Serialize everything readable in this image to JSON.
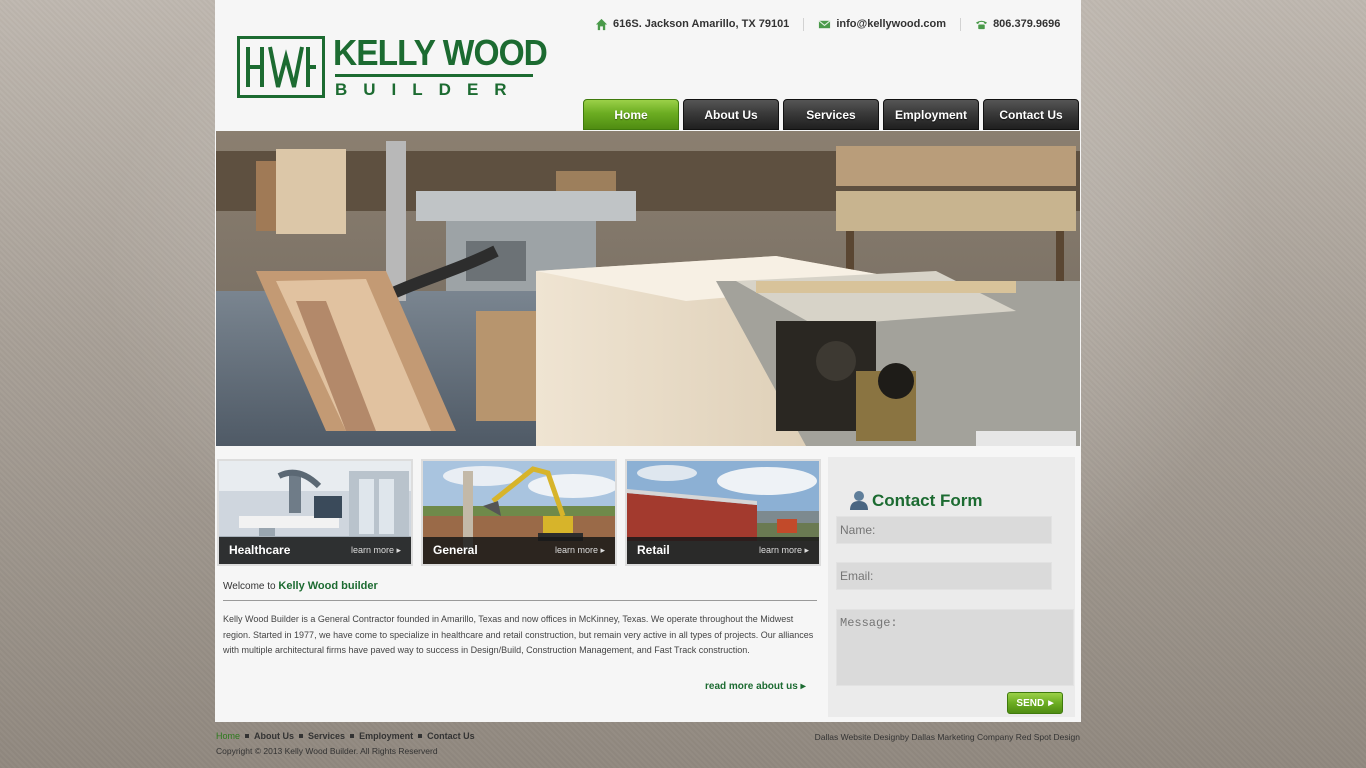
{
  "brand": {
    "title": "KELLY WOOD",
    "subtitle": "BUILDER",
    "color": "#1c6b31"
  },
  "contact_bar": {
    "address": "616S. Jackson Amarillo, TX 79101",
    "email": "info@kellywood.com",
    "phone": "806.379.9696",
    "icons": [
      "home-icon",
      "envelope-icon",
      "phone-icon"
    ]
  },
  "nav": {
    "items": [
      {
        "label": "Home",
        "active": true
      },
      {
        "label": "About Us",
        "active": false
      },
      {
        "label": "Services",
        "active": false
      },
      {
        "label": "Employment",
        "active": false
      },
      {
        "label": "Contact Us",
        "active": false
      }
    ],
    "active_color": "#6cad22"
  },
  "features": [
    {
      "title": "Healthcare",
      "more": "learn more ▸"
    },
    {
      "title": "General",
      "more": "learn more ▸"
    },
    {
      "title": "Retail",
      "more": "learn more ▸"
    }
  ],
  "welcome": {
    "prefix": "Welcome to ",
    "name": "Kelly Wood builder",
    "body": "Kelly Wood Builder is a General Contractor founded in Amarillo, Texas and now offices in McKinney, Texas. We operate throughout the Midwest region. Started in 1977, we have come to specialize in healthcare and retail construction, but remain very active in all types of projects. Our alliances with multiple architectural firms have paved way to success in Design/Build, Construction Management, and Fast Track construction.",
    "read_more": "read more about us ▸"
  },
  "contact_form": {
    "title": "Contact Form",
    "name_placeholder": "Name:",
    "email_placeholder": "Email:",
    "message_placeholder": "Message:",
    "send_label": "SEND"
  },
  "footer": {
    "links": [
      "Home",
      "About Us",
      "Services",
      "Employment",
      "Contact Us"
    ],
    "copyright": "Copyright © 2013 Kelly Wood Builder. All Rights Reserverd",
    "credit": "Dallas Website Designby Dallas Marketing Company Red Spot Design"
  }
}
